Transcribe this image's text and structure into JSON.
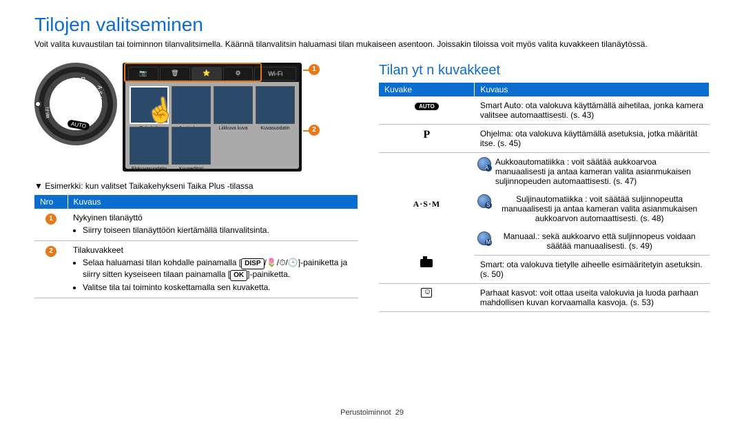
{
  "page_title": "Tilojen valitseminen",
  "intro": "Voit valita kuvaustilan tai toiminnon tilanvalitsimella. Käännä tilanvalitsin haluamasi tilan mukaiseen asentoon. Joissakin tiloissa voit myös valita kuvakkeen tilanäytössä.",
  "dial": {
    "auto": "AUTO",
    "asm": "A·S·M",
    "wifi": "Wi-Fi",
    "p": "P"
  },
  "screen": {
    "tabs": [
      "📷",
      "🗑",
      "⭐",
      "⚙",
      "Wi-Fi"
    ],
    "thumbs": [
      {
        "label": "Taikakeh"
      },
      {
        "label": "Jaettu kuva"
      },
      {
        "label": "Liikkuva kuva"
      },
      {
        "label": "Kuvasuodatin"
      },
      {
        "label": "Elokuvasuodatin"
      },
      {
        "label": "Kuvaeditori"
      }
    ]
  },
  "caption": "Esimerkki: kun valitset Taikakehykseni Taika Plus -tilassa",
  "left_table": {
    "headers": [
      "Nro",
      "Kuvaus"
    ],
    "rows": [
      {
        "num": "1",
        "title": "Nykyinen tilanäyttö",
        "bullets": [
          "Siirry toiseen tilanäyttöön kiertämällä tilanvalitsinta."
        ]
      },
      {
        "num": "2",
        "title": "Tilakuvakkeet",
        "bullets": [
          "Selaa haluamasi tilan kohdalle painamalla [DISP/🌷/⏱/🕒]-painiketta ja siirry sitten kyseiseen tilaan painamalla [OK]-painiketta.",
          "Valitse tila tai toiminto koskettamalla sen kuvaketta."
        ],
        "keys": {
          "disp": "DISP",
          "ok": "OK"
        }
      }
    ]
  },
  "right_title": "Tilan yt n kuvakkeet",
  "right_table": {
    "headers": [
      "Kuvake",
      "Kuvaus"
    ],
    "rows": [
      {
        "icon": "auto",
        "text": "Smart Auto: ota valokuva käyttämällä aihetilaa, jonka kamera valitsee automaattisesti. (s. 43)"
      },
      {
        "icon": "p",
        "text": "Ohjelma: ota valokuva käyttämällä asetuksia, jotka määrität itse. (s. 45)"
      },
      {
        "icon": "asm_a",
        "text": "Aukkoautomatiikka : voit säätää aukkoarvoa manuaalisesti ja antaa kameran valita asianmukaisen suljinnopeuden automaattisesti. (s. 47)"
      },
      {
        "icon": "asm_s",
        "text": "Suljinautomatiikka : voit säätää suljinnopeutta manuaalisesti ja antaa kameran valita asianmukaisen aukkoarvon automaattisesti. (s. 48)"
      },
      {
        "icon": "asm_m",
        "text": "Manuaal.: sekä aukkoarvo että suljinnopeus voidaan säätää manuaalisesti. (s. 49)"
      },
      {
        "icon": "smart",
        "text": "Smart: ota valokuva tietylle aiheelle esimääritetyin asetuksin. (s. 50)"
      },
      {
        "icon": "face",
        "text": "Parhaat kasvot: voit ottaa useita valokuvia ja luoda parhaan mahdollisen kuvan korvaamalla kasvoja. (s. 53)"
      }
    ],
    "asm_label": "A·S·M"
  },
  "footer": {
    "section": "Perustoiminnot",
    "page": "29"
  }
}
